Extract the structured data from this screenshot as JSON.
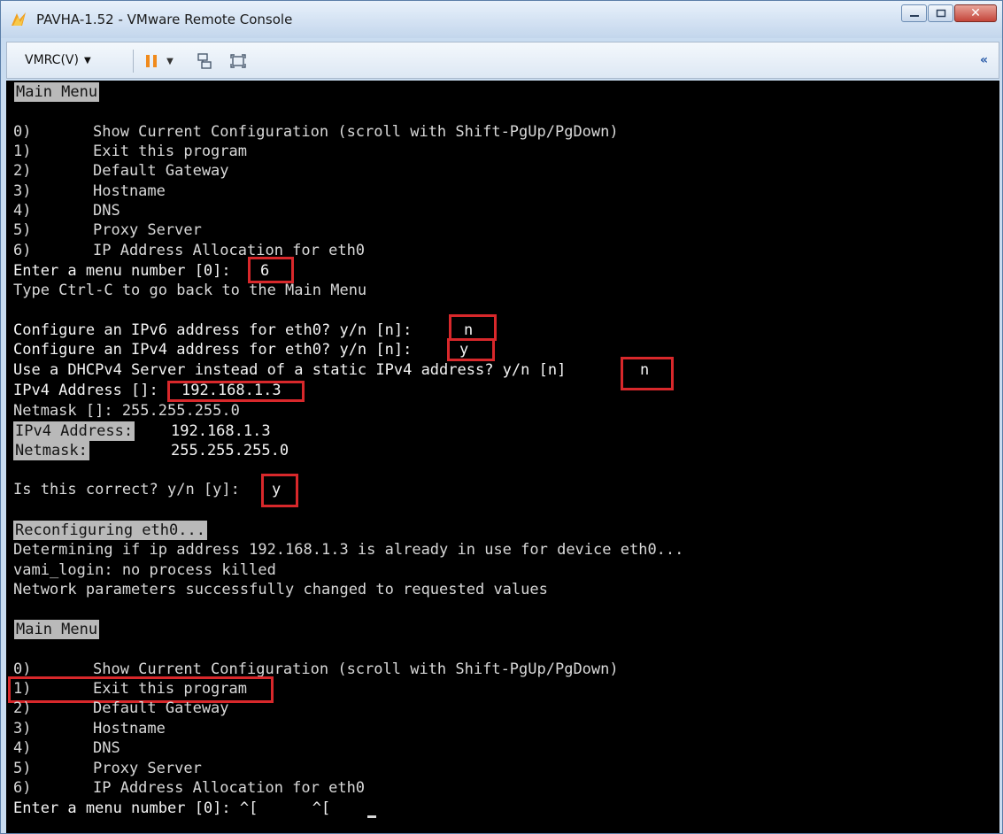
{
  "window": {
    "title": "PAVHA-1.52 - VMware Remote Console",
    "controls": [
      "minimize-icon",
      "maximize-icon",
      "close-icon"
    ],
    "accent": "#d8282b"
  },
  "toolbar": {
    "vmrc_label": "VMRC(V)",
    "icons": [
      "pause-icon",
      "send-keys-icon",
      "fullscreen-icon",
      "collapse-icon"
    ]
  },
  "console": {
    "menu1_header": "Main Menu",
    "menu1": [
      {
        "num": "0)",
        "label": "Show Current Configuration (scroll with Shift-PgUp/PgDown)"
      },
      {
        "num": "1)",
        "label": "Exit this program"
      },
      {
        "num": "2)",
        "label": "Default Gateway"
      },
      {
        "num": "3)",
        "label": "Hostname"
      },
      {
        "num": "4)",
        "label": "DNS"
      },
      {
        "num": "5)",
        "label": "Proxy Server"
      },
      {
        "num": "6)",
        "label": "IP Address Allocation for eth0"
      }
    ],
    "enter_menu_prompt": "Enter a menu number [0]:",
    "enter_menu_value": "6",
    "ctrl_c_hint": "Type Ctrl-C to go back to the Main Menu",
    "ipv6_prompt": "Configure an IPv6 address for eth0? y/n [n]:",
    "ipv6_value": "n",
    "ipv4_prompt": "Configure an IPv4 address for eth0? y/n [n]:",
    "ipv4_value": "y",
    "dhcp_prompt": "Use a DHCPv4 Server instead of a static IPv4 address? y/n [n]",
    "dhcp_value": "n",
    "ipv4_addr_prompt": "IPv4 Address []:",
    "ipv4_addr_value": "192.168.1.3",
    "netmask_prompt": "Netmask []: 255.255.255.0",
    "summary_ipv4_label": "IPv4 Address:",
    "summary_ipv4_value": "192.168.1.3",
    "summary_netmask_label": "Netmask:",
    "summary_netmask_value": "255.255.255.0",
    "correct_prompt": "Is this correct? y/n [y]:",
    "correct_value": "y",
    "reconfiguring": "Reconfiguring eth0...",
    "determining": "Determining if ip address 192.168.1.3 is already in use for device eth0...",
    "vami_login": "vami_login: no process killed",
    "network_changed": "Network parameters successfully changed to requested values",
    "menu2_header": "Main Menu",
    "menu2": [
      {
        "num": "0)",
        "label": "Show Current Configuration (scroll with Shift-PgUp/PgDown)"
      },
      {
        "num": "1)",
        "label": "Exit this program"
      },
      {
        "num": "2)",
        "label": "Default Gateway"
      },
      {
        "num": "3)",
        "label": "Hostname"
      },
      {
        "num": "4)",
        "label": "DNS"
      },
      {
        "num": "5)",
        "label": "Proxy Server"
      },
      {
        "num": "6)",
        "label": "IP Address Allocation for eth0"
      }
    ],
    "final_prompt": "Enter a menu number [0]: ^[      ^["
  }
}
